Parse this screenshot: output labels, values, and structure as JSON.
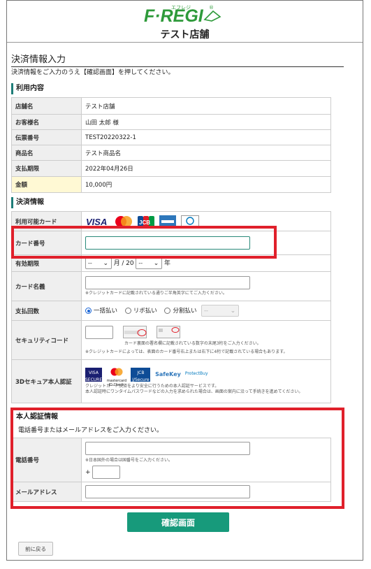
{
  "header": {
    "logo": "F·REGI",
    "logo_kana": "エフレジ",
    "logo_reg": "®",
    "store_name": "テスト店舗"
  },
  "page": {
    "title": "決済情報入力",
    "lead": "決済情報をご入力のうえ【確認画面】を押してください。"
  },
  "usage": {
    "heading": "利用内容",
    "rows": [
      {
        "label": "店舗名",
        "value": "テスト店舗"
      },
      {
        "label": "お客様名",
        "value": "山田 太郎 様"
      },
      {
        "label": "伝票番号",
        "value": "TEST20220322-1"
      },
      {
        "label": "商品名",
        "value": "テスト商品名"
      },
      {
        "label": "支払期限",
        "value": "2022年04月26日"
      },
      {
        "label": "金額",
        "value": "10,000円"
      }
    ]
  },
  "payment": {
    "heading": "決済情報",
    "cards_label": "利用可能カード",
    "card_brands": [
      "VISA",
      "Mastercard",
      "JCB",
      "AMERICAN EXPRESS",
      "Diners Club"
    ],
    "card_number_label": "カード番号",
    "card_number_value": "",
    "expiry_label": "有効期限",
    "expiry_month": "--",
    "expiry_month_unit": "月",
    "expiry_sep": "/",
    "expiry_prefix": "20",
    "expiry_year": "--",
    "expiry_year_unit": "年",
    "holder_label": "カード名義",
    "holder_note": "※クレジットカードに記載されている通りご半角英字にてご入力ください。",
    "installment_label": "支払回数",
    "installment_options": [
      "一括払い",
      "リボ払い",
      "分割払い"
    ],
    "installment_select": "--",
    "security_label": "セキュリティコード",
    "security_note1": "カード裏面の署名欄に記載されている数字の末尾3桁をご入力ください。",
    "security_note2": "※クレジットカードによっては、表面のカード番号右上または右下に4桁で記載されている場合もあります。",
    "ds_label": "3Dセキュア本人認証",
    "ds_logos": [
      "VISA SECURE",
      "mastercard ID Check",
      "JCB J/Secure",
      "SafeKey",
      "ProtectBuy"
    ],
    "ds_note1": "クレジットカード決済をより安全に行うための本人認証サービスです。",
    "ds_note2": "本人認証時にワンタイムパスワードなどの入力を求められた場合は、画面の案内に沿って手続きを進めてください。"
  },
  "identity": {
    "heading": "本人認証情報",
    "lead": "電話番号またはメールアドレスをご入力ください。",
    "phone_label": "電話番号",
    "phone_note": "※日本国外の場合は国番号をご入力ください。",
    "phone_plus": "+",
    "email_label": "メールアドレス"
  },
  "buttons": {
    "confirm": "確認画面",
    "back": "前に戻る"
  },
  "colors": {
    "accent": "#179a7b",
    "highlight_box": "#e0202b",
    "logo_green": "#2e9a3a"
  }
}
